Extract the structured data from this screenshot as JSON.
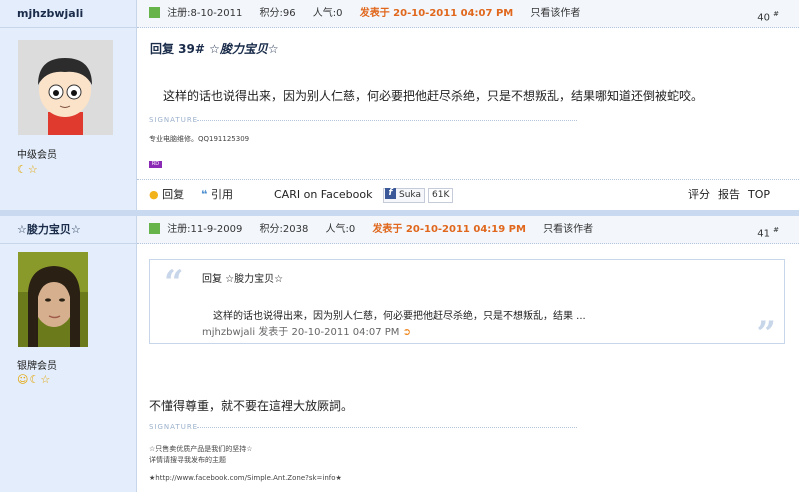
{
  "post1": {
    "author": "mjhzbwjali",
    "rank": "中级会员",
    "stars": "☾☆",
    "register": "注册:8-10-2011",
    "points": "积分:96",
    "popularity": "人气:0",
    "posted": "发表于 20-10-2011 04:07 PM",
    "author_only": "只看该作者",
    "floor": "40",
    "floor_mark": "#",
    "title_prefix": "回复 39#",
    "title_user": "☆朘力宝贝☆",
    "body": "这样的话也说得出来，因为别人仁慈，何必要把他赶尽杀绝，只是不想叛乱，结果哪知道还倒被蛇咬。",
    "sig_label": "SIGNATURE",
    "sig_text": "专业电脑维修。QQ191125309",
    "badge": "RD",
    "actions": {
      "reply": "回复",
      "quote": "引用",
      "facebook": "CARI on Facebook",
      "suka": "Suka",
      "suka_count": "61K",
      "rate": "评分",
      "report": "报告",
      "top": "TOP"
    }
  },
  "post2": {
    "author": "☆朘力宝贝☆",
    "rank": "银牌会员",
    "stars": "☺☾☆",
    "register": "注册:11-9-2009",
    "points": "积分:2038",
    "popularity": "人气:0",
    "posted": "发表于 20-10-2011 04:19 PM",
    "author_only": "只看该作者",
    "floor": "41",
    "floor_mark": "#",
    "quote_title": "回复 ☆朘力宝贝☆",
    "quote_body": "这样的话也说得出来，因为别人仁慈，何必要把他赶尽杀绝，只是不想叛乱，结果 ...",
    "quote_source": "mjhzbwjali 发表于 20-10-2011 04:07 PM",
    "body": "不懂得尊重，就不要在這裡大放厥詞。",
    "sig_label": "SIGNATURE",
    "sig_line1": "☆只售卖优质产品是我们的坚持☆",
    "sig_line2": "详情请搜寻我发布的主题",
    "sig_line3": "★http://www.facebook.com/Simple.Ant.Zone?sk=info★"
  },
  "colors": {
    "sidebar_bg": "#e3edfb",
    "date_orange": "#e0671c",
    "separator": "#c9d9ef"
  }
}
